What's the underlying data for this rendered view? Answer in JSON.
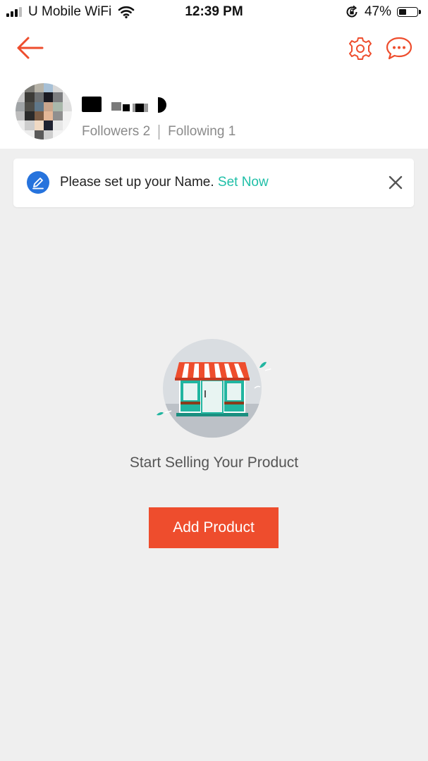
{
  "status_bar": {
    "carrier": "U Mobile WiFi",
    "time": "12:39 PM",
    "battery": "47%",
    "battery_level": 0.47
  },
  "header": {
    "icons": {
      "back": "arrow-left-icon",
      "settings": "gear-icon",
      "chat": "chat-bubble-icon"
    },
    "accent_color": "#ee4d2d"
  },
  "profile": {
    "followers": "Followers 2",
    "following": "Following 1"
  },
  "banner": {
    "message": "Please set up your Name.",
    "action": "Set Now",
    "action_color": "#1fbfa7",
    "icon": "pen-icon",
    "close_icon": "close-icon"
  },
  "empty_state": {
    "text": "Start Selling Your Product",
    "button": "Add Product",
    "illustration": "shop-storefront-icon"
  }
}
